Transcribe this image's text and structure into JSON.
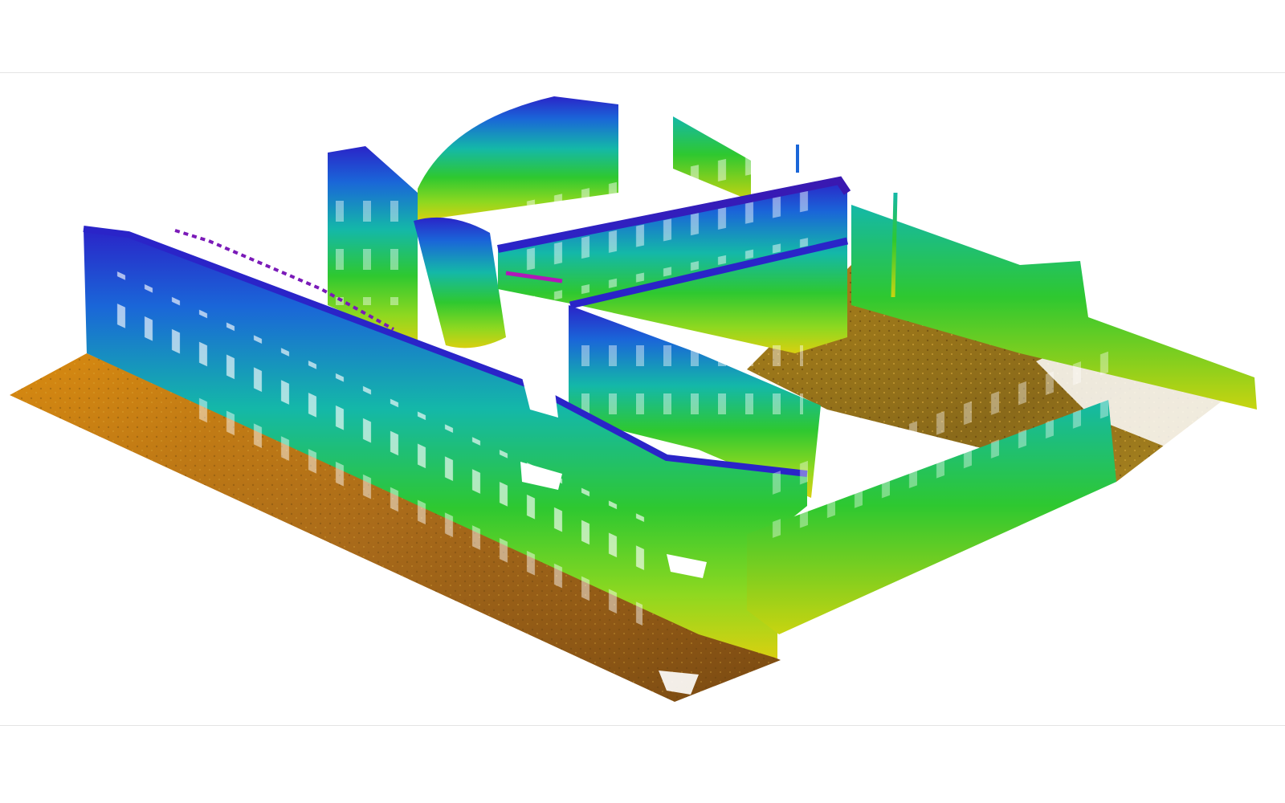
{
  "scene": {
    "subject": "point-cloud-building",
    "background": "#ffffff",
    "rule_color": "#e4e4e4",
    "palette": {
      "ground_dark": "#7a4a12",
      "ground_mid": "#a86a1a",
      "ground_light": "#c8901e",
      "orange": "#d88a10",
      "yellow": "#d8d010",
      "green": "#2ec830",
      "teal": "#14b8a8",
      "blue": "#1a66d8",
      "indigo": "#2a24c8",
      "violet": "#7a1ab8"
    }
  }
}
